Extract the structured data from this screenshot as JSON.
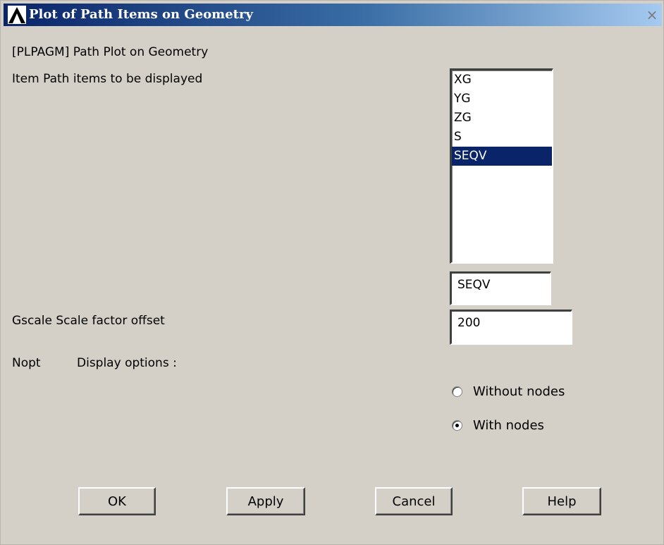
{
  "window": {
    "title": "Plot of Path Items on Geometry",
    "close_glyph": "×",
    "logo_icon": "ansys-logo-icon"
  },
  "command_label": "[PLPAGM]  Path Plot on Geometry",
  "item": {
    "label": "Item  Path items to be displayed",
    "list": [
      "XG",
      "YG",
      "ZG",
      "S",
      "SEQV"
    ],
    "selected_index": 4,
    "value": "SEQV"
  },
  "gscale": {
    "label": "Gscale   Scale factor offset",
    "value": "200"
  },
  "nopt": {
    "label_key": "Nopt",
    "label_desc": "Display options :",
    "options": [
      {
        "label": "Without nodes",
        "selected": false
      },
      {
        "label": "With nodes",
        "selected": true
      }
    ]
  },
  "buttons": {
    "ok": "OK",
    "apply": "Apply",
    "cancel": "Cancel",
    "help": "Help"
  },
  "colors": {
    "selection": "#0a246a",
    "dialog_bg": "#d4d0c8"
  }
}
